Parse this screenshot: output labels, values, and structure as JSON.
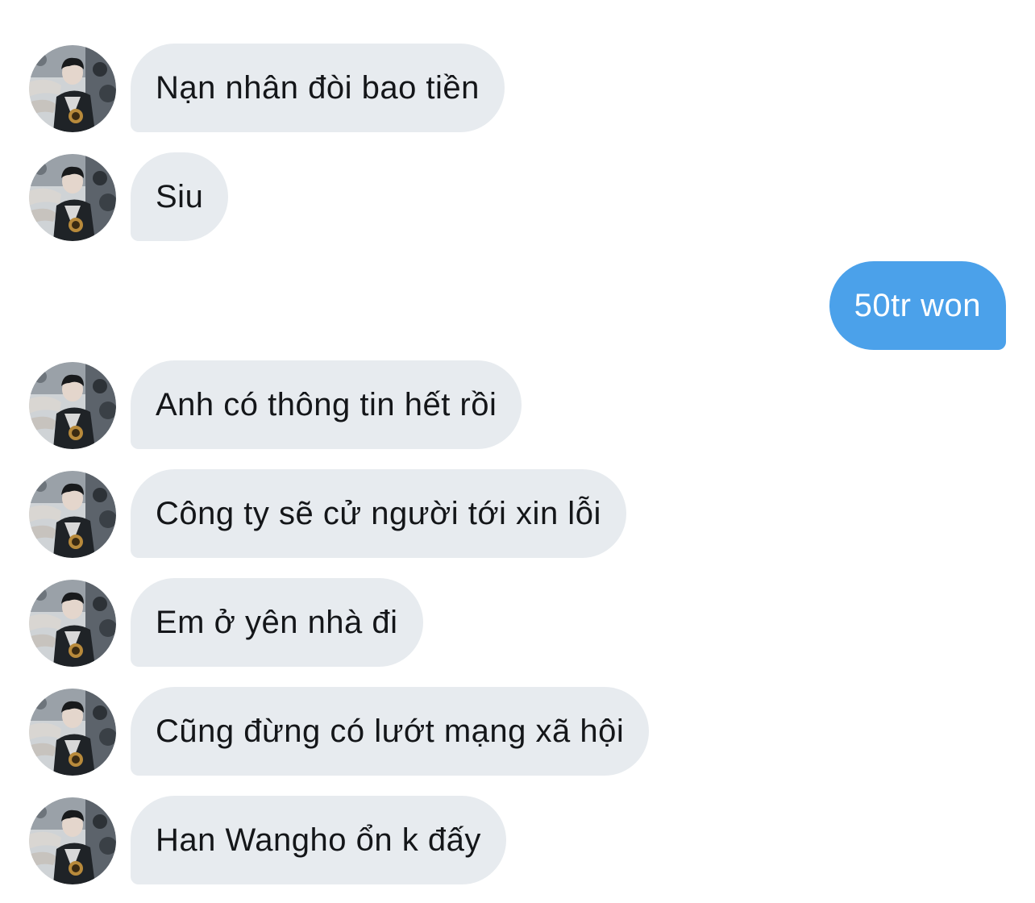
{
  "conversation": {
    "messages": [
      {
        "direction": "incoming",
        "text": "Nạn nhân đòi bao tiền"
      },
      {
        "direction": "incoming",
        "text": "Siu"
      },
      {
        "direction": "outgoing",
        "text": "50tr won"
      },
      {
        "direction": "incoming",
        "text": "Anh có thông tin hết rồi"
      },
      {
        "direction": "incoming",
        "text": "Công ty sẽ cử người tới xin lỗi"
      },
      {
        "direction": "incoming",
        "text": "Em ở yên nhà đi"
      },
      {
        "direction": "incoming",
        "text": "Cũng đừng có lướt mạng xã hội"
      },
      {
        "direction": "incoming",
        "text": "Han Wangho ổn k đấy"
      }
    ]
  },
  "colors": {
    "incoming_bubble": "#e7ebef",
    "incoming_text": "#141619",
    "outgoing_bubble": "#4ba1ea",
    "outgoing_text": "#ffffff"
  },
  "icons": {
    "avatar": "contact-avatar-photo"
  }
}
